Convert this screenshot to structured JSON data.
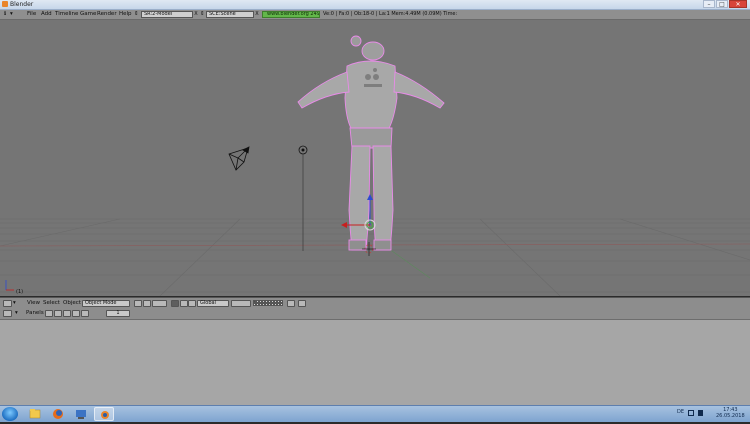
{
  "window": {
    "title": "Blender",
    "controls": [
      "–",
      "□",
      "✕"
    ]
  },
  "info_header": {
    "menus": [
      "File",
      "Add",
      "Timeline",
      "Game",
      "Render",
      "Help"
    ],
    "screen_field": "SR:2-Model",
    "scene_field": "SCE:Scene",
    "close_symbol": "X",
    "link": "www.blender.org 249.2",
    "stats": "Ve:0 | Fa:0 | Ob:18-0 | La:1   Mem:4.49M (0.09M)   Time:"
  },
  "viewport": {
    "frame_label": "(1)",
    "colors": {
      "background": "#757575",
      "grid": "#6b6b6b",
      "selection": "#e88be8"
    }
  },
  "view3d_header": {
    "menus": [
      "View",
      "Select",
      "Object"
    ],
    "mode": "Object Mode",
    "orientation": "Global"
  },
  "buttons_header": {
    "panels_label": "Panels",
    "page_number": "1"
  },
  "taskbar": {
    "icons": [
      "start-orb-icon",
      "file-explorer-icon",
      "firefox-icon",
      "file-manager-icon",
      "blender-icon"
    ],
    "language": "DE",
    "time": "17:43",
    "date": "26.05.2018"
  }
}
